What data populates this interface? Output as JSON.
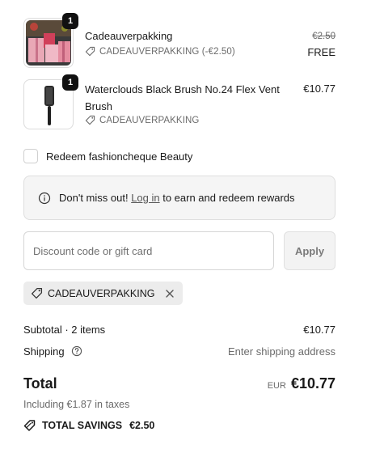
{
  "items": [
    {
      "quantity": "1",
      "title": "Cadeauverpakking",
      "discount_tag": "CADEAUVERPAKKING (-€2.50)",
      "original_price": "€2.50",
      "price": "FREE",
      "thumb_icon": "gift-box-image"
    },
    {
      "quantity": "1",
      "title": "Waterclouds Black Brush No.24 Flex Vent Brush",
      "discount_tag": "CADEAUVERPAKKING",
      "price": "€10.77",
      "thumb_icon": "hair-brush-image"
    }
  ],
  "redeem": {
    "label": "Redeem fashioncheque Beauty",
    "checked": false
  },
  "notice": {
    "prefix": "Don't miss out! ",
    "link": "Log in",
    "suffix": " to earn and redeem rewards"
  },
  "discount": {
    "placeholder": "Discount code or gift card",
    "value": "",
    "apply_label": "Apply"
  },
  "applied_code": {
    "label": "CADEAUVERPAKKING"
  },
  "summary": {
    "subtotal_label": "Subtotal · 2 items",
    "subtotal_value": "€10.77",
    "shipping_label": "Shipping",
    "shipping_value": "Enter shipping address",
    "total_label": "Total",
    "currency": "EUR",
    "total_value": "€10.77",
    "taxes": "Including €1.87 in taxes",
    "savings_label": "TOTAL SAVINGS",
    "savings_value": "€2.50"
  },
  "colors": {
    "text": "#1a1a1a",
    "muted": "#6b6b6b",
    "border": "#dcdcdc",
    "badge": "#111111",
    "notice_bg": "#f5f5f5"
  }
}
